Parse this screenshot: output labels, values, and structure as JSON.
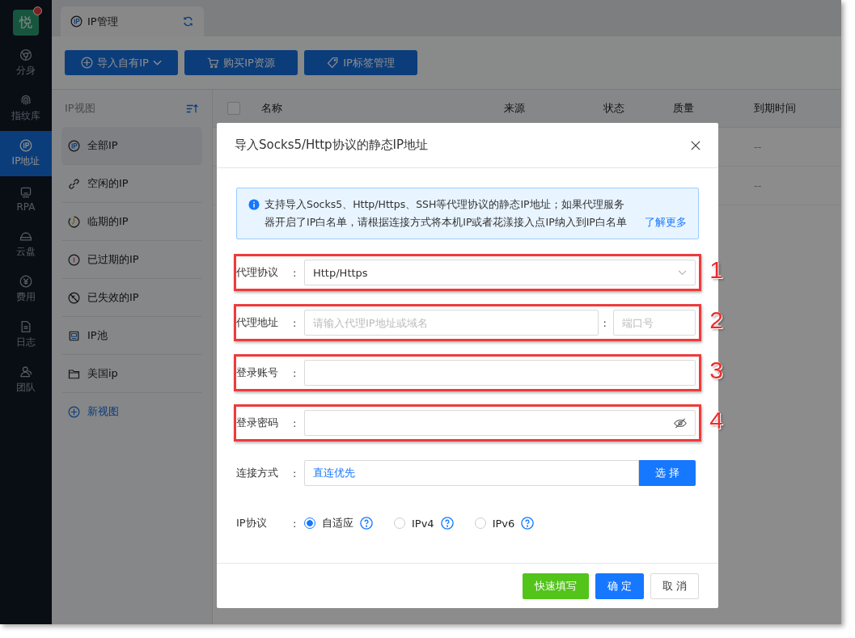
{
  "nav": {
    "logo": "悦",
    "badge": true,
    "items": [
      {
        "label": "分身",
        "selected": false
      },
      {
        "label": "指纹库",
        "selected": false
      },
      {
        "label": "IP地址",
        "selected": true
      },
      {
        "label": "RPA",
        "selected": false
      },
      {
        "label": "云盘",
        "selected": false
      },
      {
        "label": "费用",
        "selected": false
      },
      {
        "label": "日志",
        "selected": false
      },
      {
        "label": "团队",
        "selected": false
      }
    ]
  },
  "tabs": [
    {
      "label": "IP管理"
    }
  ],
  "toolbar": [
    {
      "label": "导入自有IP",
      "dropdown": true
    },
    {
      "label": "购买IP资源",
      "dropdown": false
    },
    {
      "label": "IP标签管理",
      "dropdown": false
    }
  ],
  "views": {
    "title": "IP视图",
    "items": [
      {
        "label": "全部IP",
        "selected": true
      },
      {
        "label": "空闲的IP",
        "selected": false
      },
      {
        "label": "临期的IP",
        "selected": false
      },
      {
        "label": "已过期的IP",
        "selected": false
      },
      {
        "label": "已失效的IP",
        "selected": false
      },
      {
        "label": "IP池",
        "selected": false
      },
      {
        "label": "美国ip",
        "selected": false
      }
    ],
    "add": "新视图"
  },
  "table": {
    "select_all_checked": false,
    "columns": [
      "名称",
      "来源",
      "状态",
      "质量",
      "到期时间"
    ],
    "rows": [
      {
        "expiry": "--"
      },
      {
        "expiry": "--"
      }
    ]
  },
  "dialog": {
    "title": "导入Socks5/Http协议的静态IP地址",
    "notice": {
      "text": "支持导入Socks5、Http/Https、SSH等代理协议的静态IP地址；如果代理服务器开启了IP白名单，请根据连接方式将本机IP或者花漾接入点IP纳入到IP白名单",
      "link": "了解更多"
    },
    "fields": [
      {
        "kind": "select",
        "label": "代理协议",
        "colon": ":",
        "value": "Http/Https",
        "annotation": "1"
      },
      {
        "kind": "host-port",
        "label": "代理地址",
        "colon": ":",
        "placeholder": "请输入代理IP地址或域名",
        "port_colon": ":",
        "port_placeholder": "端口号",
        "annotation": "2"
      },
      {
        "kind": "text",
        "label": "登录账号",
        "colon": ":",
        "annotation": "3"
      },
      {
        "kind": "password",
        "label": "登录密码",
        "colon": ":",
        "annotation": "4"
      },
      {
        "kind": "picker",
        "label": "连接方式",
        "colon": ":",
        "value": "直连优先",
        "button": "选 择"
      },
      {
        "kind": "radio",
        "label": "IP协议",
        "colon": ":",
        "options": [
          {
            "label": "自适应",
            "selected": true
          },
          {
            "label": "IPv4",
            "selected": false
          },
          {
            "label": "IPv6",
            "selected": false
          }
        ]
      }
    ],
    "buttons": [
      {
        "label": "快速填写",
        "kind": "success"
      },
      {
        "label": "确 定",
        "kind": "primary"
      },
      {
        "label": "取 消",
        "kind": "default"
      }
    ]
  }
}
